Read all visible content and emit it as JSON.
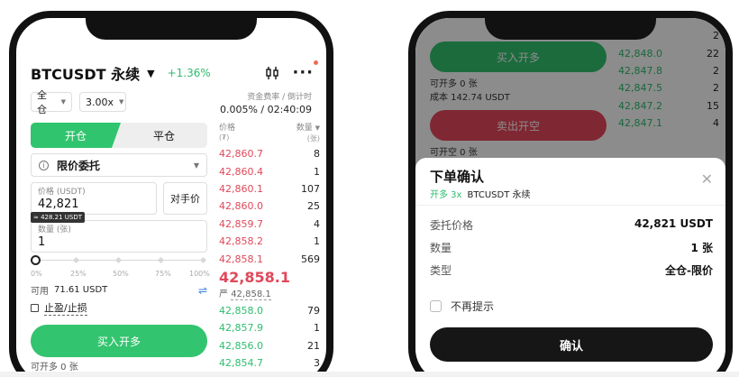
{
  "left": {
    "header": {
      "symbol": "BTCUSDT 永续",
      "change": "+1.36%"
    },
    "margin_mode": "全仓",
    "leverage": "3.00x",
    "funding": {
      "label": "资金费率 / 倒计时",
      "value": "0.005% / 02:40:09"
    },
    "tabs": {
      "open": "开仓",
      "close": "平仓"
    },
    "order_type": "限价委托",
    "price": {
      "label": "价格 (USDT)",
      "value": "42,821",
      "approx": "≈ 428.21 USDT"
    },
    "counterparty_button": "对手价",
    "quantity": {
      "label": "数量 (张)",
      "value": "1"
    },
    "slider": {
      "labels": [
        "0%",
        "25%",
        "50%",
        "75%",
        "100%"
      ],
      "value_percent": 0
    },
    "available": {
      "label": "可用",
      "value": "71.61 USDT"
    },
    "tpsl_label": "止盈/止损",
    "buy_button": "买入开多",
    "can_open": "可开多 0 张",
    "orderbook": {
      "price_header": "价格",
      "price_unit": "(₮)",
      "qty_header": "数量",
      "qty_unit": "(张)",
      "asks": [
        {
          "price": "42,860.7",
          "qty": "8"
        },
        {
          "price": "42,860.4",
          "qty": "1"
        },
        {
          "price": "42,860.1",
          "qty": "107"
        },
        {
          "price": "42,860.0",
          "qty": "25"
        },
        {
          "price": "42,859.7",
          "qty": "4"
        },
        {
          "price": "42,858.2",
          "qty": "1"
        },
        {
          "price": "42,858.1",
          "qty": "569"
        }
      ],
      "last_price": "42,858.1",
      "mark_prefix": "严",
      "mark_price": "42,858.1",
      "bids": [
        {
          "price": "42,858.0",
          "qty": "79"
        },
        {
          "price": "42,857.9",
          "qty": "1"
        },
        {
          "price": "42,856.0",
          "qty": "21"
        },
        {
          "price": "42,854.7",
          "qty": "3"
        }
      ]
    }
  },
  "right": {
    "bg": {
      "buy_button": "买入开多",
      "sell_button": "卖出开空",
      "can_open_long": "可开多 0 张",
      "cost": "成本 142.74 USDT",
      "can_open_short": "可开空 0 张",
      "bids": [
        {
          "price": "",
          "qty": "2"
        },
        {
          "price": "42,848.0",
          "qty": "22"
        },
        {
          "price": "42,847.8",
          "qty": "2"
        },
        {
          "price": "42,847.5",
          "qty": "2"
        },
        {
          "price": "42,847.2",
          "qty": "15"
        },
        {
          "price": "42,847.1",
          "qty": "4"
        }
      ]
    },
    "dialog": {
      "title": "下单确认",
      "side": "开多 3x",
      "symbol": "BTCUSDT 永续",
      "rows": [
        {
          "label": "委托价格",
          "value": "42,821 USDT"
        },
        {
          "label": "数量",
          "value": "1 张"
        },
        {
          "label": "类型",
          "value": "全仓-限价"
        }
      ],
      "no_remind": "不再提示",
      "confirm_button": "确认"
    }
  }
}
